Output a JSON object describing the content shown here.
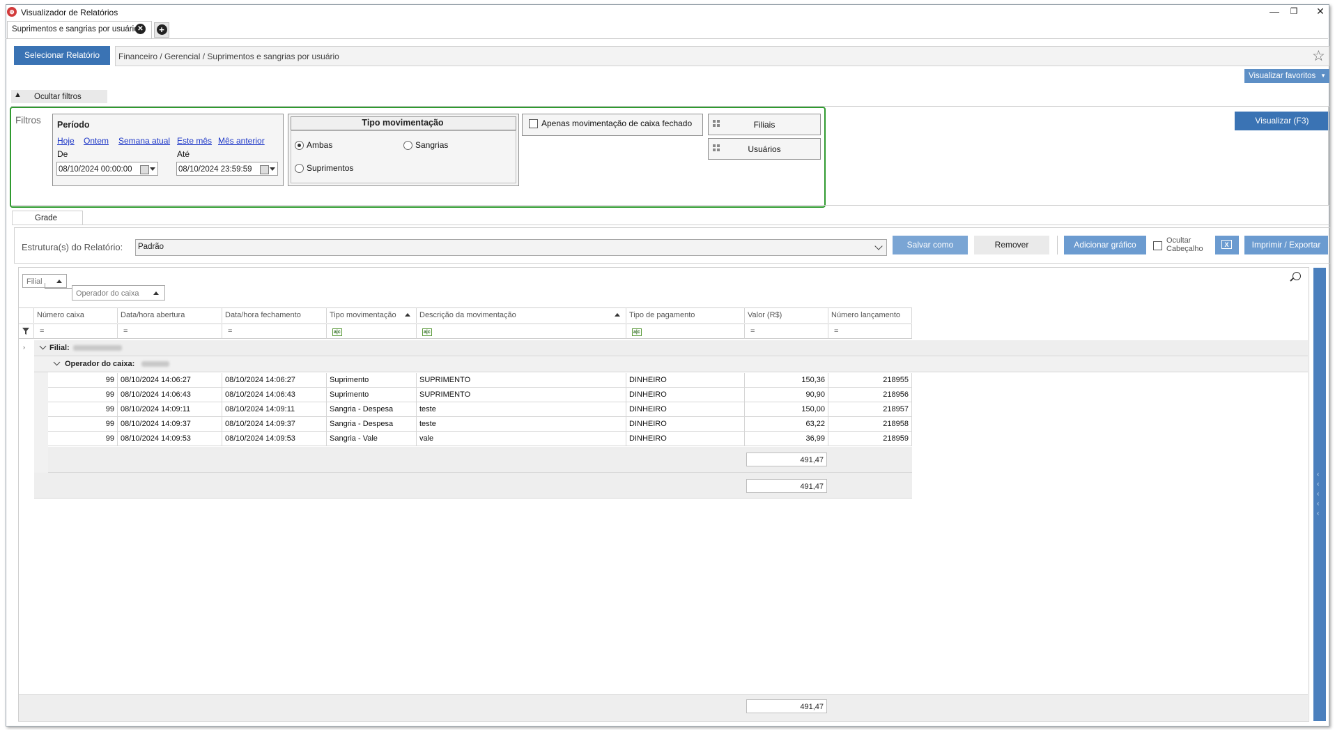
{
  "window": {
    "title": "Visualizador de Relatórios",
    "icon": "app-logo-icon",
    "controls": {
      "minimize": "—",
      "restore": "❐",
      "close": "✕"
    }
  },
  "tabs": [
    {
      "label": "Suprimentos e sangrias por usuário",
      "active": true
    }
  ],
  "toolbar": {
    "select_report": "Selecionar Relatório",
    "report_path": "Financeiro / Gerencial / Suprimentos e sangrias por usuário",
    "favorites_button": "Visualizar favoritos"
  },
  "filters": {
    "hide_label": "Ocultar filtros",
    "section_label": "Filtros",
    "periodo": {
      "title": "Período",
      "shortcuts": [
        "Hoje",
        "Ontem",
        "Semana atual",
        "Este mês",
        "Mês anterior"
      ],
      "from_label": "De",
      "from_value": "08/10/2024 00:00:00",
      "to_label": "Até",
      "to_value": "08/10/2024 23:59:59"
    },
    "tipo": {
      "title": "Tipo movimentação",
      "options": [
        "Ambas",
        "Sangrias",
        "Suprimentos"
      ],
      "selected": "Ambas"
    },
    "apenas_fechado": {
      "label": "Apenas movimentação de caixa fechado",
      "checked": false
    },
    "filiais_button": "Filiais",
    "usuarios_button": "Usuários",
    "visualizar_button": "Visualizar (F3)"
  },
  "grade": {
    "tab_label": "Grade",
    "structure_label": "Estrutura(s) do Relatório:",
    "structure_value": "Padrão",
    "buttons": {
      "save_as": "Salvar como",
      "remove": "Remover",
      "add_chart": "Adicionar gráfico",
      "hide_header_line1": "Ocultar",
      "hide_header_line2": "Cabeçalho",
      "print_export": "Imprimir / Exportar"
    },
    "group_chips": [
      "Filial",
      "Operador do caixa"
    ],
    "columns": [
      "Número caixa",
      "Data/hora abertura",
      "Data/hora fechamento",
      "Tipo movimentação",
      "Descrição da movimentação",
      "Tipo de pagamento",
      "Valor (R$)",
      "Número lançamento"
    ],
    "filter_equals": "=",
    "group_filial_label": "Filial:",
    "group_operador_label": "Operador do caixa:",
    "rows": [
      [
        "99",
        "08/10/2024 14:06:27",
        "08/10/2024 14:06:27",
        "Suprimento",
        "SUPRIMENTO",
        "DINHEIRO",
        "150,36",
        "218955"
      ],
      [
        "99",
        "08/10/2024 14:06:43",
        "08/10/2024 14:06:43",
        "Suprimento",
        "SUPRIMENTO",
        "DINHEIRO",
        "90,90",
        "218956"
      ],
      [
        "99",
        "08/10/2024 14:09:11",
        "08/10/2024 14:09:11",
        "Sangria - Despesa",
        "teste",
        "DINHEIRO",
        "150,00",
        "218957"
      ],
      [
        "99",
        "08/10/2024 14:09:37",
        "08/10/2024 14:09:37",
        "Sangria - Despesa",
        "teste",
        "DINHEIRO",
        "63,22",
        "218958"
      ],
      [
        "99",
        "08/10/2024 14:09:53",
        "08/10/2024 14:09:53",
        "Sangria - Vale",
        "vale",
        "DINHEIRO",
        "36,99",
        "218959"
      ]
    ],
    "subtotal_operador": "491,47",
    "subtotal_filial": "491,47",
    "grand_total": "491,47"
  }
}
